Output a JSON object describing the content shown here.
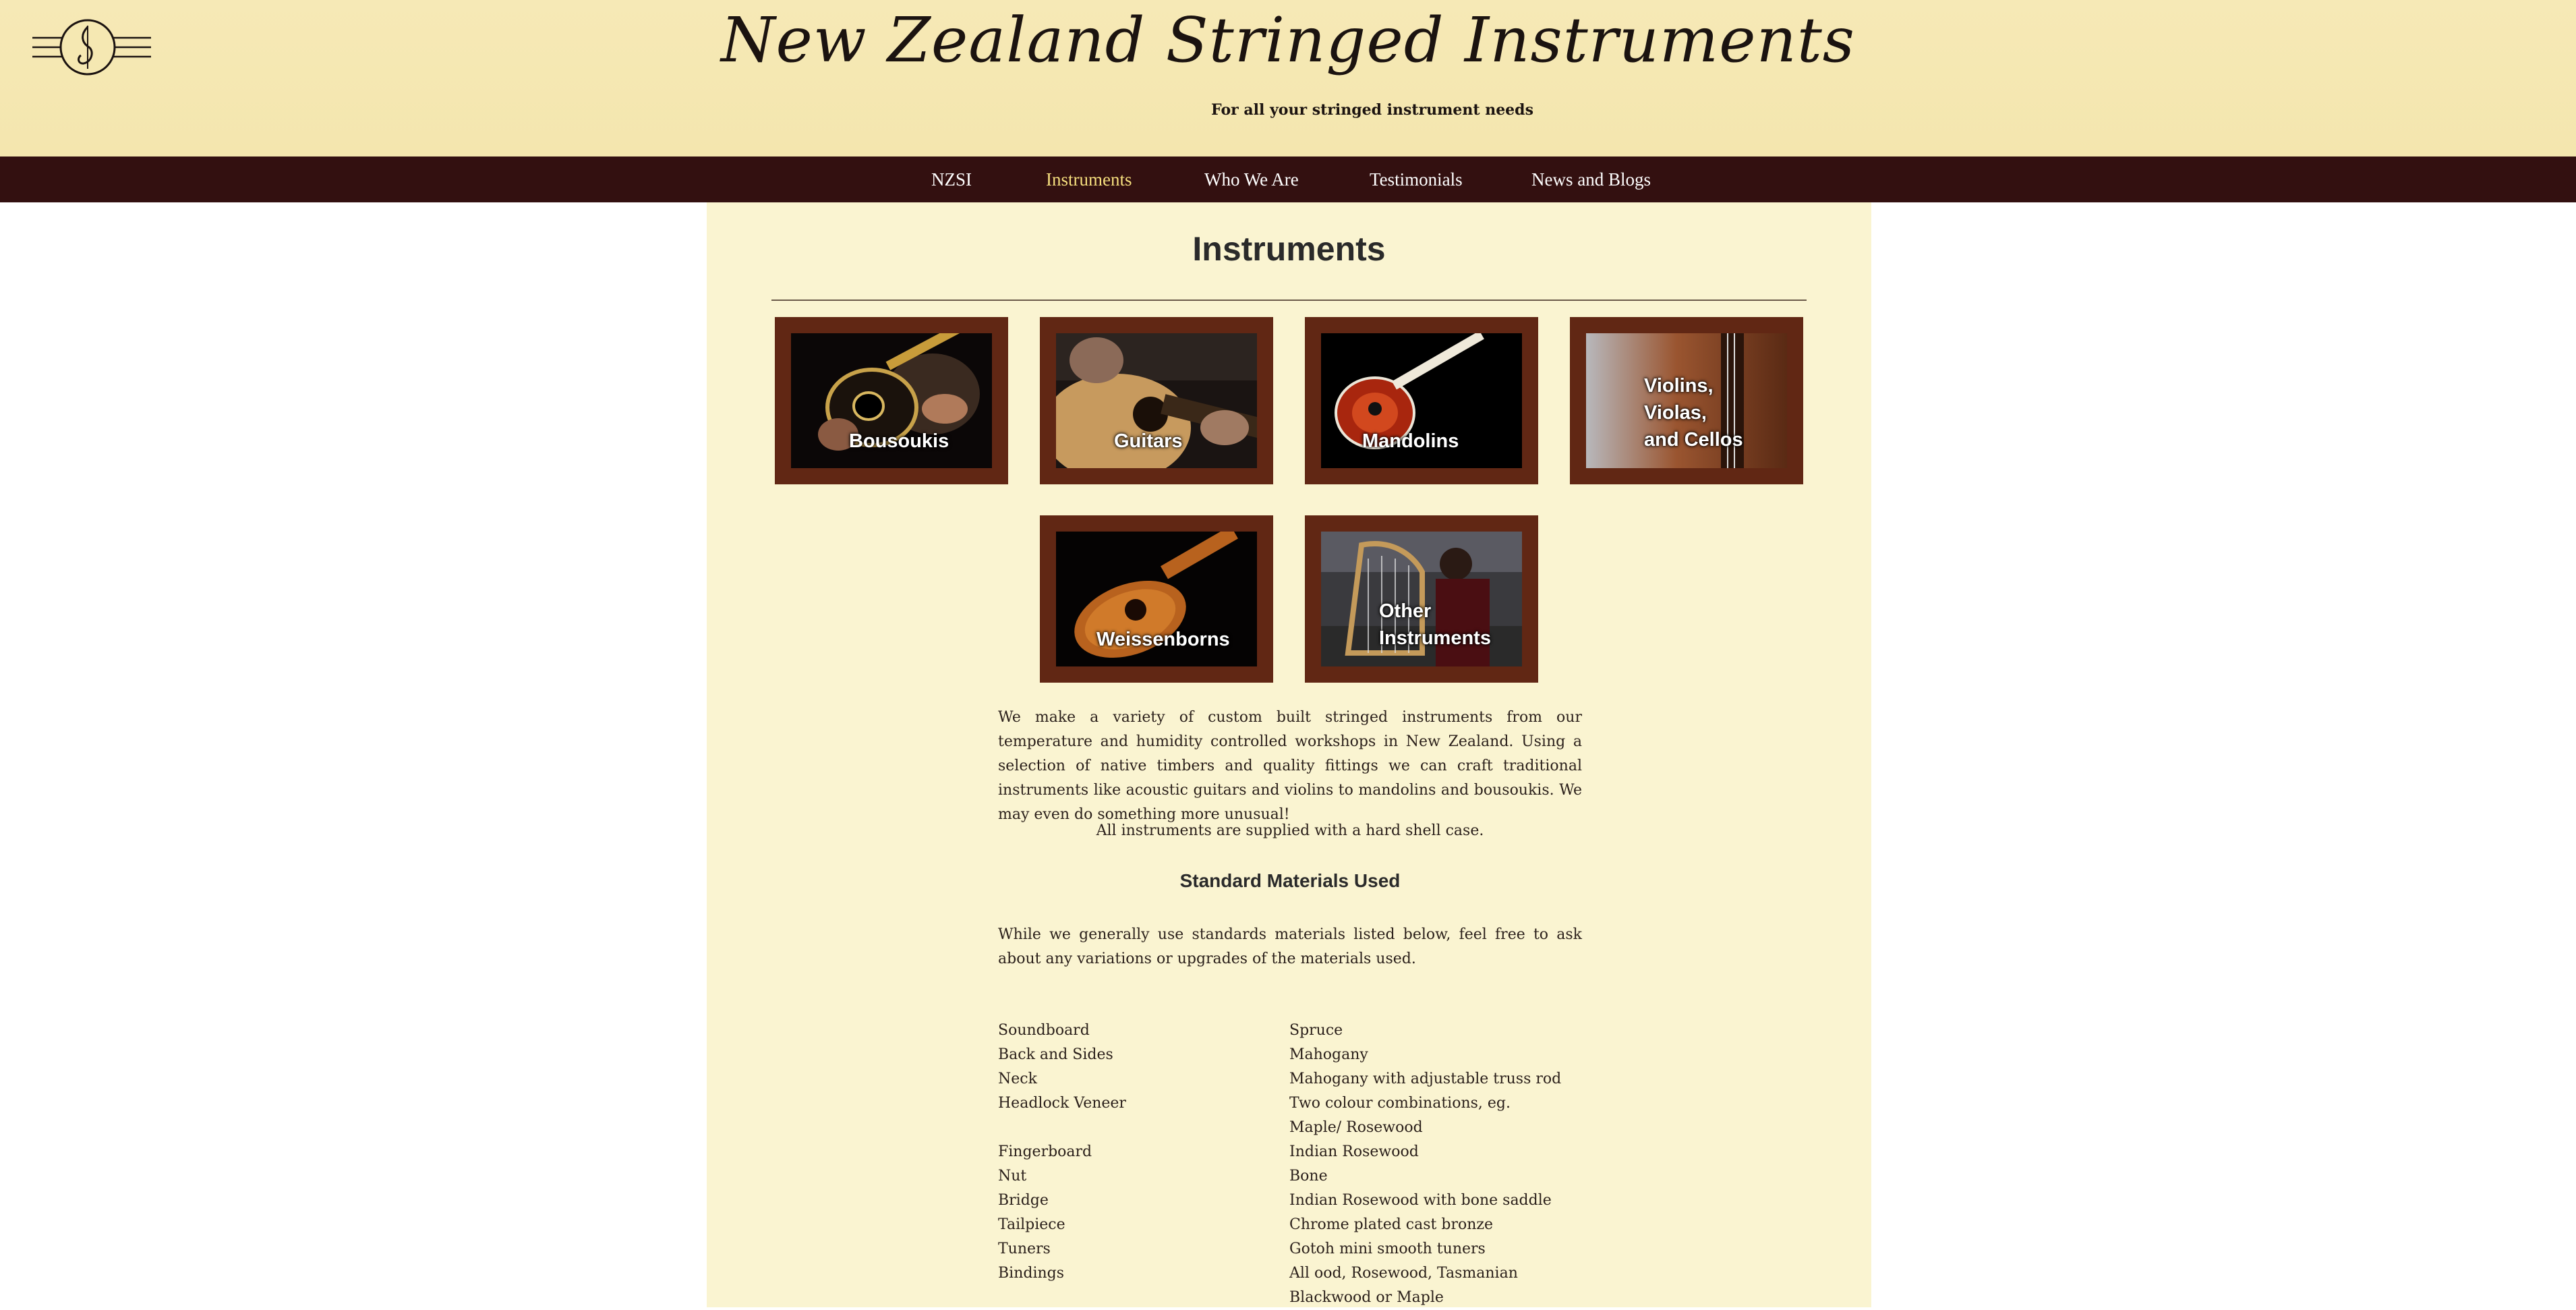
{
  "header": {
    "site_title": "New Zealand Stringed Instruments",
    "tagline": "For all your stringed instrument needs"
  },
  "nav": {
    "items": [
      {
        "label": "NZSI"
      },
      {
        "label": "Instruments"
      },
      {
        "label": "Who We Are"
      },
      {
        "label": "Testimonials"
      },
      {
        "label": "News and Blogs"
      }
    ],
    "active": "Instruments"
  },
  "main": {
    "title": "Instruments",
    "tiles": [
      {
        "label": "Bousoukis"
      },
      {
        "label": "Guitars"
      },
      {
        "label": "Mandolins"
      },
      {
        "label_lines": [
          "Violins,",
          "Violas,",
          "and Cellos"
        ]
      },
      {
        "label": "Weissenborns"
      },
      {
        "label_lines": [
          "Other",
          "Instruments"
        ]
      }
    ],
    "intro": "We make a variety of custom built stringed instruments from our temperature and humidity controlled workshops in New Zealand. Using a selection of native timbers and quality fittings we can craft traditional instruments like acoustic guitars and violins to mandolins and bousoukis. We may even do something more unusual!",
    "case_note": "All instruments are supplied with a hard shell case.",
    "materials_heading": "Standard Materials Used",
    "materials_intro": "While we generally use standards materials listed below, feel free to ask about any variations or upgrades of the materials used.",
    "materials": [
      {
        "part": "Soundboard",
        "material": "Spruce"
      },
      {
        "part": "Back and Sides",
        "material": "Mahogany"
      },
      {
        "part": "Neck",
        "material": "Mahogany with adjustable truss rod"
      },
      {
        "part": "Headlock Veneer",
        "material": "Two colour combinations, eg. Maple/ Rosewood"
      },
      {
        "part": "Fingerboard",
        "material": "Indian Rosewood"
      },
      {
        "part": "Nut",
        "material": "Bone"
      },
      {
        "part": "Bridge",
        "material": "Indian Rosewood with bone saddle"
      },
      {
        "part": "Tailpiece",
        "material": "Chrome plated cast bronze"
      },
      {
        "part": "Tuners",
        "material": "Gotoh mini smooth tuners"
      },
      {
        "part": "Bindings",
        "material": "All ood, Rosewood, Tasmanian Blackwood or Maple"
      }
    ]
  },
  "colors": {
    "header_bg": "#f5e8b2",
    "nav_bg": "#331010",
    "nav_active": "#f6df7e",
    "panel_bg": "#faf4d1",
    "tile_frame": "#612714"
  },
  "icons": [
    "site-logo-icon"
  ]
}
